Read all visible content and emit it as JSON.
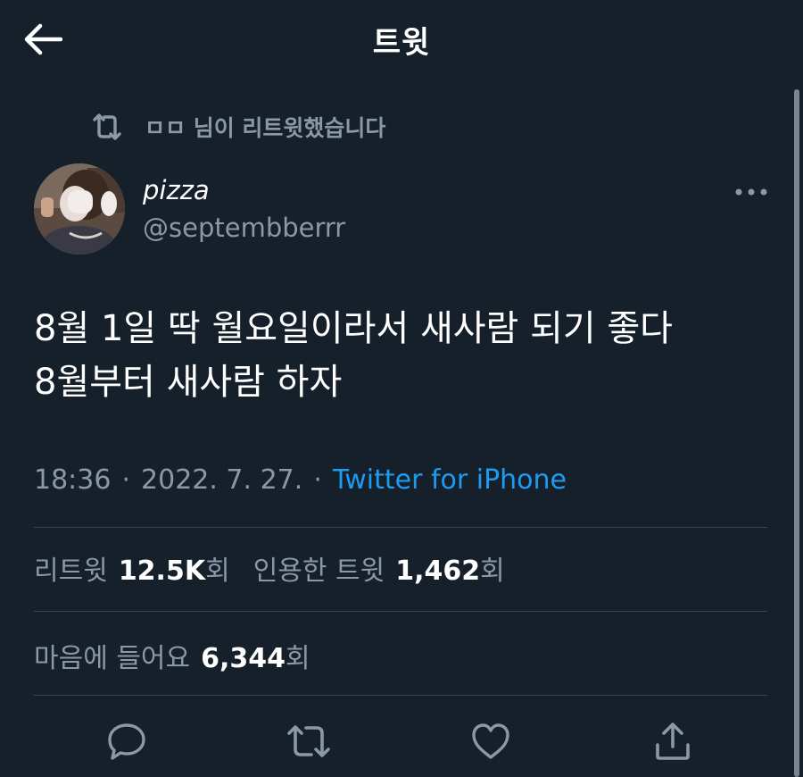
{
  "header": {
    "title": "트윗"
  },
  "retweet_context": {
    "text": "ㅁㅁ 님이 리트윗했습니다"
  },
  "tweet": {
    "display_name": "pizza",
    "handle": "@septembberrr",
    "text": "8월 1일 딱 월요일이라서 새사람 되기 좋다\n8월부터 새사람 하자",
    "time": "18:36",
    "date": "2022. 7. 27.",
    "separator": "·",
    "source": "Twitter for iPhone"
  },
  "stats": {
    "retweets_label": "리트윗",
    "retweets_value": "12.5K",
    "retweets_unit": "회",
    "quotes_label": "인용한 트윗",
    "quotes_value": "1,462",
    "quotes_unit": "회",
    "likes_label": "마음에 들어요",
    "likes_value": "6,344",
    "likes_unit": "회"
  },
  "actions": {
    "icons": [
      "reply-icon",
      "retweet-icon",
      "like-icon",
      "share-icon"
    ]
  },
  "colors": {
    "background": "#15202b",
    "secondary_text": "#8b98a5",
    "link": "#1d9bf0",
    "divider": "#38444d"
  }
}
